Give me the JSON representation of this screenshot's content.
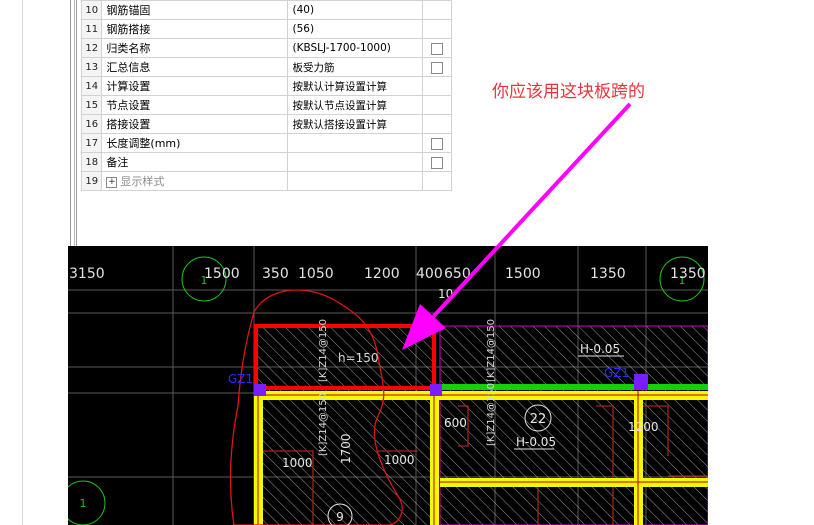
{
  "properties": {
    "rows": [
      {
        "num": "10",
        "name": "钢筋锚固",
        "value": "(40)",
        "checkbox": false
      },
      {
        "num": "11",
        "name": "钢筋搭接",
        "value": "(56)",
        "checkbox": false
      },
      {
        "num": "12",
        "name": "归类名称",
        "value": "(KBSLJ-1700-1000)",
        "checkbox": true
      },
      {
        "num": "13",
        "name": "汇总信息",
        "value": "板受力筋",
        "checkbox": true
      },
      {
        "num": "14",
        "name": "计算设置",
        "value": "按默认计算设置计算",
        "checkbox": false
      },
      {
        "num": "15",
        "name": "节点设置",
        "value": "按默认节点设置计算",
        "checkbox": false
      },
      {
        "num": "16",
        "name": "搭接设置",
        "value": "按默认搭接设置计算",
        "checkbox": false
      },
      {
        "num": "17",
        "name": "长度调整(mm)",
        "value": "",
        "checkbox": true
      },
      {
        "num": "18",
        "name": "备注",
        "value": "",
        "checkbox": true
      },
      {
        "num": "19",
        "name": "显示样式",
        "value": "",
        "checkbox": false,
        "expandable": true
      }
    ]
  },
  "annotation": {
    "text": "你应该用这块板跨的",
    "color": "#e8343c"
  },
  "arrow_color": "#ff00ff",
  "cad": {
    "dimensions": [
      "3150",
      "1500",
      "350",
      "1050",
      "1200",
      "400",
      "650",
      "1500",
      "1350",
      "1350"
    ],
    "axis_labels": {
      "top_a": "1",
      "top_b": "1",
      "left": "1",
      "bottom": "9"
    },
    "labels": {
      "slab_h": "h=150",
      "h_top": "H-0.05",
      "h_mid": "H-0.05",
      "circle_22": "22",
      "gz_left": "GZ1",
      "gz_right": "GZ1",
      "dim_600": "600",
      "dim_1200": "1200",
      "dim_1000a": "1000",
      "dim_1700": "1700",
      "dim_1000b": "1000",
      "dim_10": "10",
      "rebar_left_1": "[K]Z14@150",
      "rebar_left_2": "[K]Z14@150",
      "rebar_right_1": "[K]Z14@150",
      "rebar_right_2": "[K]Z14@150"
    }
  }
}
